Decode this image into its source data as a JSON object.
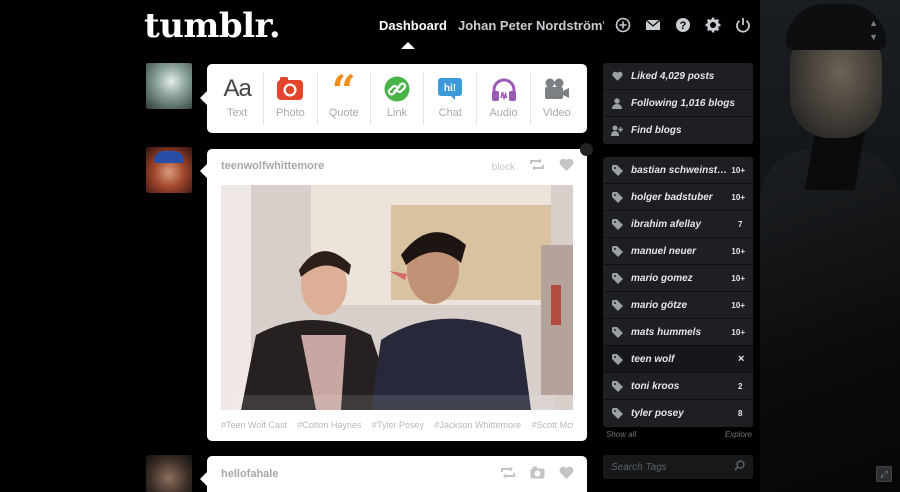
{
  "header": {
    "logo": "tumblr.",
    "nav_dashboard": "Dashboard",
    "nav_blog": "Johan Peter Nordström's...",
    "icons": [
      "new-post-icon",
      "inbox-icon",
      "help-icon",
      "settings-icon",
      "logout-icon"
    ]
  },
  "composer": {
    "types": [
      {
        "label": "Text",
        "icon": "text-icon",
        "glyph": "Aa"
      },
      {
        "label": "Photo",
        "icon": "camera-icon",
        "color": "#e2452c"
      },
      {
        "label": "Quote",
        "icon": "quote-icon",
        "glyph": "“",
        "color": "#f18e1b"
      },
      {
        "label": "Link",
        "icon": "link-icon",
        "color": "#49b249"
      },
      {
        "label": "Chat",
        "icon": "chat-icon",
        "glyph": "hi!",
        "color": "#3b9ad9"
      },
      {
        "label": "Audio",
        "icon": "headphones-icon",
        "color": "#9b59b6"
      },
      {
        "label": "Video",
        "icon": "video-camera-icon",
        "color": "#7c7f84"
      }
    ]
  },
  "post": {
    "author": "teenwolfwhittemore",
    "block_label": "block",
    "tags": [
      "#Teen Wolf Cast",
      "#Colton Haynes",
      "#Tyler Posey",
      "#Jackson Whittemore",
      "#Scott McCa"
    ]
  },
  "post2": {
    "author": "hellofahale"
  },
  "sidebar": {
    "stats": [
      {
        "label": "Liked 4,029 posts",
        "icon": "heart-icon"
      },
      {
        "label": "Following 1,016 blogs",
        "icon": "user-icon"
      },
      {
        "label": "Find blogs",
        "icon": "add-user-icon"
      }
    ],
    "tags": [
      {
        "label": "bastian schweinste...",
        "count": "10+"
      },
      {
        "label": "holger badstuber",
        "count": "10+"
      },
      {
        "label": "ibrahim afellay",
        "count": "7"
      },
      {
        "label": "manuel neuer",
        "count": "10+"
      },
      {
        "label": "mario gomez",
        "count": "10+"
      },
      {
        "label": "mario götze",
        "count": "10+"
      },
      {
        "label": "mats hummels",
        "count": "10+"
      },
      {
        "label": "teen wolf",
        "count": "×"
      },
      {
        "label": "toni kroos",
        "count": "2"
      },
      {
        "label": "tyler posey",
        "count": "8"
      }
    ],
    "show_all": "Show all",
    "explore": "Explore",
    "search_placeholder": "Search Tags"
  }
}
